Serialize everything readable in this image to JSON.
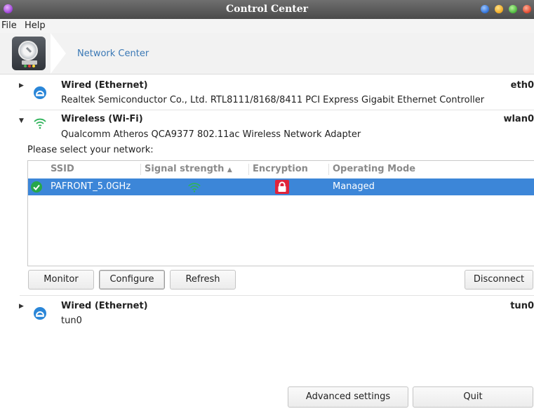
{
  "window": {
    "title": "Control Center"
  },
  "menu": {
    "file": "File",
    "help": "Help"
  },
  "header": {
    "breadcrumb": "Network Center"
  },
  "devices": [
    {
      "name": "Wired (Ethernet)",
      "iface": "eth0",
      "description": "Realtek Semiconductor Co., Ltd. RTL8111/8168/8411 PCI Express Gigabit Ethernet Controller",
      "expanded": false
    },
    {
      "name": "Wireless (Wi-Fi)",
      "iface": "wlan0",
      "description": "Qualcomm Atheros QCA9377 802.11ac Wireless Network Adapter",
      "expanded": true
    },
    {
      "name": "Wired (Ethernet)",
      "iface": "tun0",
      "description": "tun0",
      "expanded": false
    }
  ],
  "wifi": {
    "prompt": "Please select your network:",
    "columns": {
      "ssid": "SSID",
      "signal": "Signal strength",
      "signal_sort": "▲",
      "encryption": "Encryption",
      "mode": "Operating Mode"
    },
    "networks": [
      {
        "ssid": "PAFRONT_5.0GHz",
        "mode": "Managed",
        "connected": true,
        "encrypted": true
      }
    ],
    "buttons": {
      "monitor": "Monitor",
      "configure": "Configure",
      "refresh": "Refresh",
      "disconnect": "Disconnect"
    }
  },
  "footer": {
    "advanced": "Advanced settings",
    "quit": "Quit"
  },
  "colors": {
    "selection": "#3c86d8",
    "link": "#3a78b5",
    "wifi_green": "#2fb35a",
    "lock_red": "#e0243a",
    "titlebar": "#555555"
  }
}
